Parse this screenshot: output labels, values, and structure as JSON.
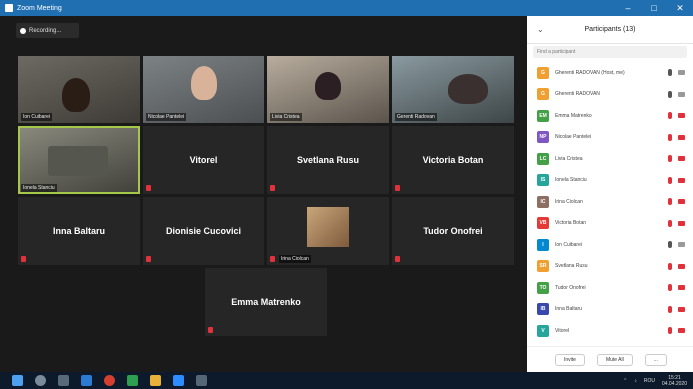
{
  "window": {
    "title": "Zoom Meeting",
    "controls": [
      "minimize-icon",
      "maximize-icon",
      "close-icon"
    ]
  },
  "recording": {
    "label": "Recording..."
  },
  "tiles": {
    "video_1": "Ion Cuibarei",
    "video_2": "Nicolae Pantelei",
    "video_3": "Livia Cristea",
    "video_4": "Gerenti Radovan",
    "video_5": "Ionela Stanciu",
    "vitorel": "Vitorel",
    "svetlana": "Svetlana Rusu",
    "victoria": "Victoria Botan",
    "inna": "Inna Baltaru",
    "dionisie": "Dionisie Cucovici",
    "irina": "Irina Ciolcan",
    "tudor": "Tudor Onofrei",
    "emma": "Emma Matrenko"
  },
  "panel": {
    "title": "Participants (13)",
    "search_placeholder": "Find a participant",
    "participants": [
      {
        "initial": "G",
        "name": "Gherenti RADOVAN (Host, me)",
        "color": "#f0a030",
        "mic": "on",
        "cam": "on"
      },
      {
        "initial": "G",
        "name": "Gherenti RADOVAN",
        "color": "#f0a030",
        "mic": "on",
        "cam": "on"
      },
      {
        "initial": "EM",
        "name": "Emma Matrenko",
        "color": "#43a047",
        "mic": "off",
        "cam": "off"
      },
      {
        "initial": "NP",
        "name": "Nicolae Pantelei",
        "color": "#7e57c2",
        "mic": "off",
        "cam": "off"
      },
      {
        "initial": "LC",
        "name": "Livia Cristea",
        "color": "#43a047",
        "mic": "off",
        "cam": "off"
      },
      {
        "initial": "IS",
        "name": "Ionela Stanciu",
        "color": "#26a69a",
        "mic": "off",
        "cam": "off"
      },
      {
        "initial": "IC",
        "name": "Irina Ciolcan",
        "color": "#8d6e63",
        "mic": "off",
        "cam": "off"
      },
      {
        "initial": "VB",
        "name": "Victoria Botan",
        "color": "#e53935",
        "mic": "off",
        "cam": "off"
      },
      {
        "initial": "I",
        "name": "Ion Cuibarei",
        "color": "#0288d1",
        "mic": "on",
        "cam": "on"
      },
      {
        "initial": "SR",
        "name": "Svetlana Rusu",
        "color": "#f0a030",
        "mic": "off",
        "cam": "off"
      },
      {
        "initial": "TO",
        "name": "Tudor Onofrei",
        "color": "#43a047",
        "mic": "off",
        "cam": "off"
      },
      {
        "initial": "IB",
        "name": "Inna Baltaru",
        "color": "#3949ab",
        "mic": "off",
        "cam": "off"
      },
      {
        "initial": "V",
        "name": "Vitorel",
        "color": "#26a69a",
        "mic": "off",
        "cam": "off"
      }
    ],
    "invite_label": "Invite",
    "mute_all_label": "Mute All",
    "more_label": "..."
  },
  "taskbar": {
    "time": "15:21",
    "date": "04.04.2020",
    "lang": "ROU"
  }
}
